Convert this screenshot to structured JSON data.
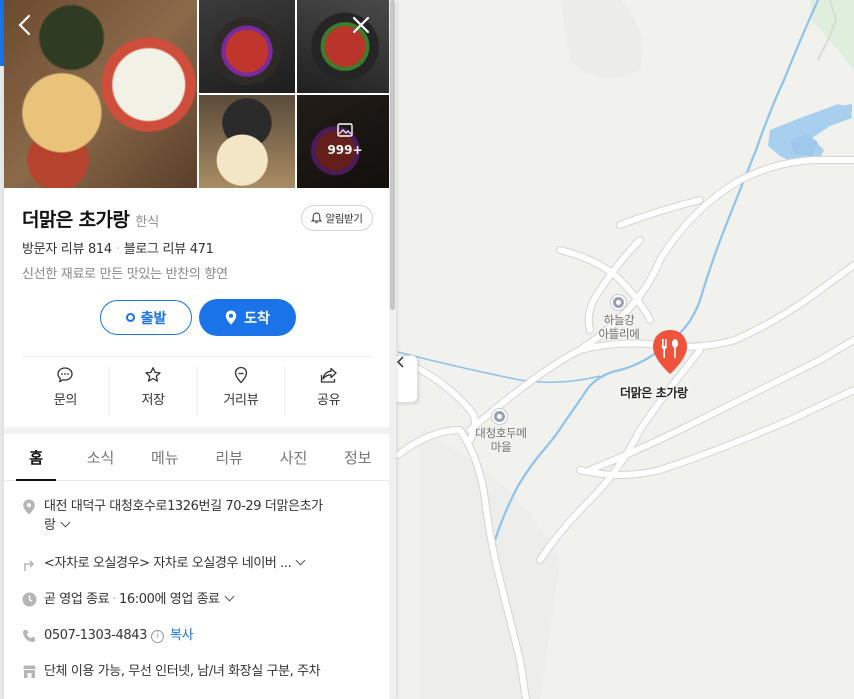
{
  "place": {
    "name": "더맑은 초가랑",
    "category": "한식",
    "visitor_reviews": "방문자 리뷰 814",
    "blog_reviews": "블로그 리뷰 471",
    "description": "신선한 재료로 만든 맛있는 반찬의 향연",
    "photo_count": "999+"
  },
  "buttons": {
    "alarm": "알림받기",
    "depart": "출발",
    "arrive": "도착",
    "back": "back-icon",
    "close": "close-icon"
  },
  "actions": [
    {
      "label": "문의",
      "icon": "chat-icon"
    },
    {
      "label": "저장",
      "icon": "star-icon"
    },
    {
      "label": "거리뷰",
      "icon": "location-outline-icon"
    },
    {
      "label": "공유",
      "icon": "share-icon"
    }
  ],
  "tabs": [
    "홈",
    "소식",
    "메뉴",
    "리뷰",
    "사진",
    "정보"
  ],
  "active_tab": "홈",
  "info": {
    "address_line1": "대전 대덕구 대청호수로1326번길 70-29 더맑은초가",
    "address_line2": "랑",
    "directions": "<자차로 오실경우> 자차로 오실경우 네이버 ...",
    "hours_status": "곧 영업 종료",
    "hours_detail": "16:00에 영업 종료",
    "phone": "0507-1303-4843",
    "copy": "복사",
    "facilities": "단체 이용 가능, 무선 인터넷, 남/녀 화장실 구분, 주차"
  },
  "map": {
    "poi1_line1": "하늘강",
    "poi1_line2": "아뜰리에",
    "poi2_line1": "대청호두메",
    "poi2_line2": "마을",
    "pin_label": "더맑은 초가랑"
  },
  "colors": {
    "accent": "#1a73e8",
    "pin": "#f0533c",
    "water": "#a9cfee",
    "river": "#8fc3ea"
  }
}
